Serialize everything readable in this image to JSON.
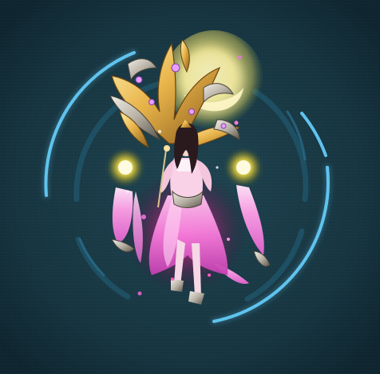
{
  "colors": {
    "background": "#15303b",
    "ring_accent": "#5fc3ee",
    "ring_dark": "#1d4a5c",
    "moon_glow": "#fff7b0",
    "gold": "#e8b44a",
    "robe_pink": "#f07ad8",
    "lantern_yellow": "#ffe74a",
    "aura_magenta": "#ff3aa0"
  },
  "icons": {
    "character": "character-model-icon",
    "wings": "golden-wings-icon",
    "lantern": "glowing-lantern-icon",
    "moon": "crescent-moon-icon"
  }
}
